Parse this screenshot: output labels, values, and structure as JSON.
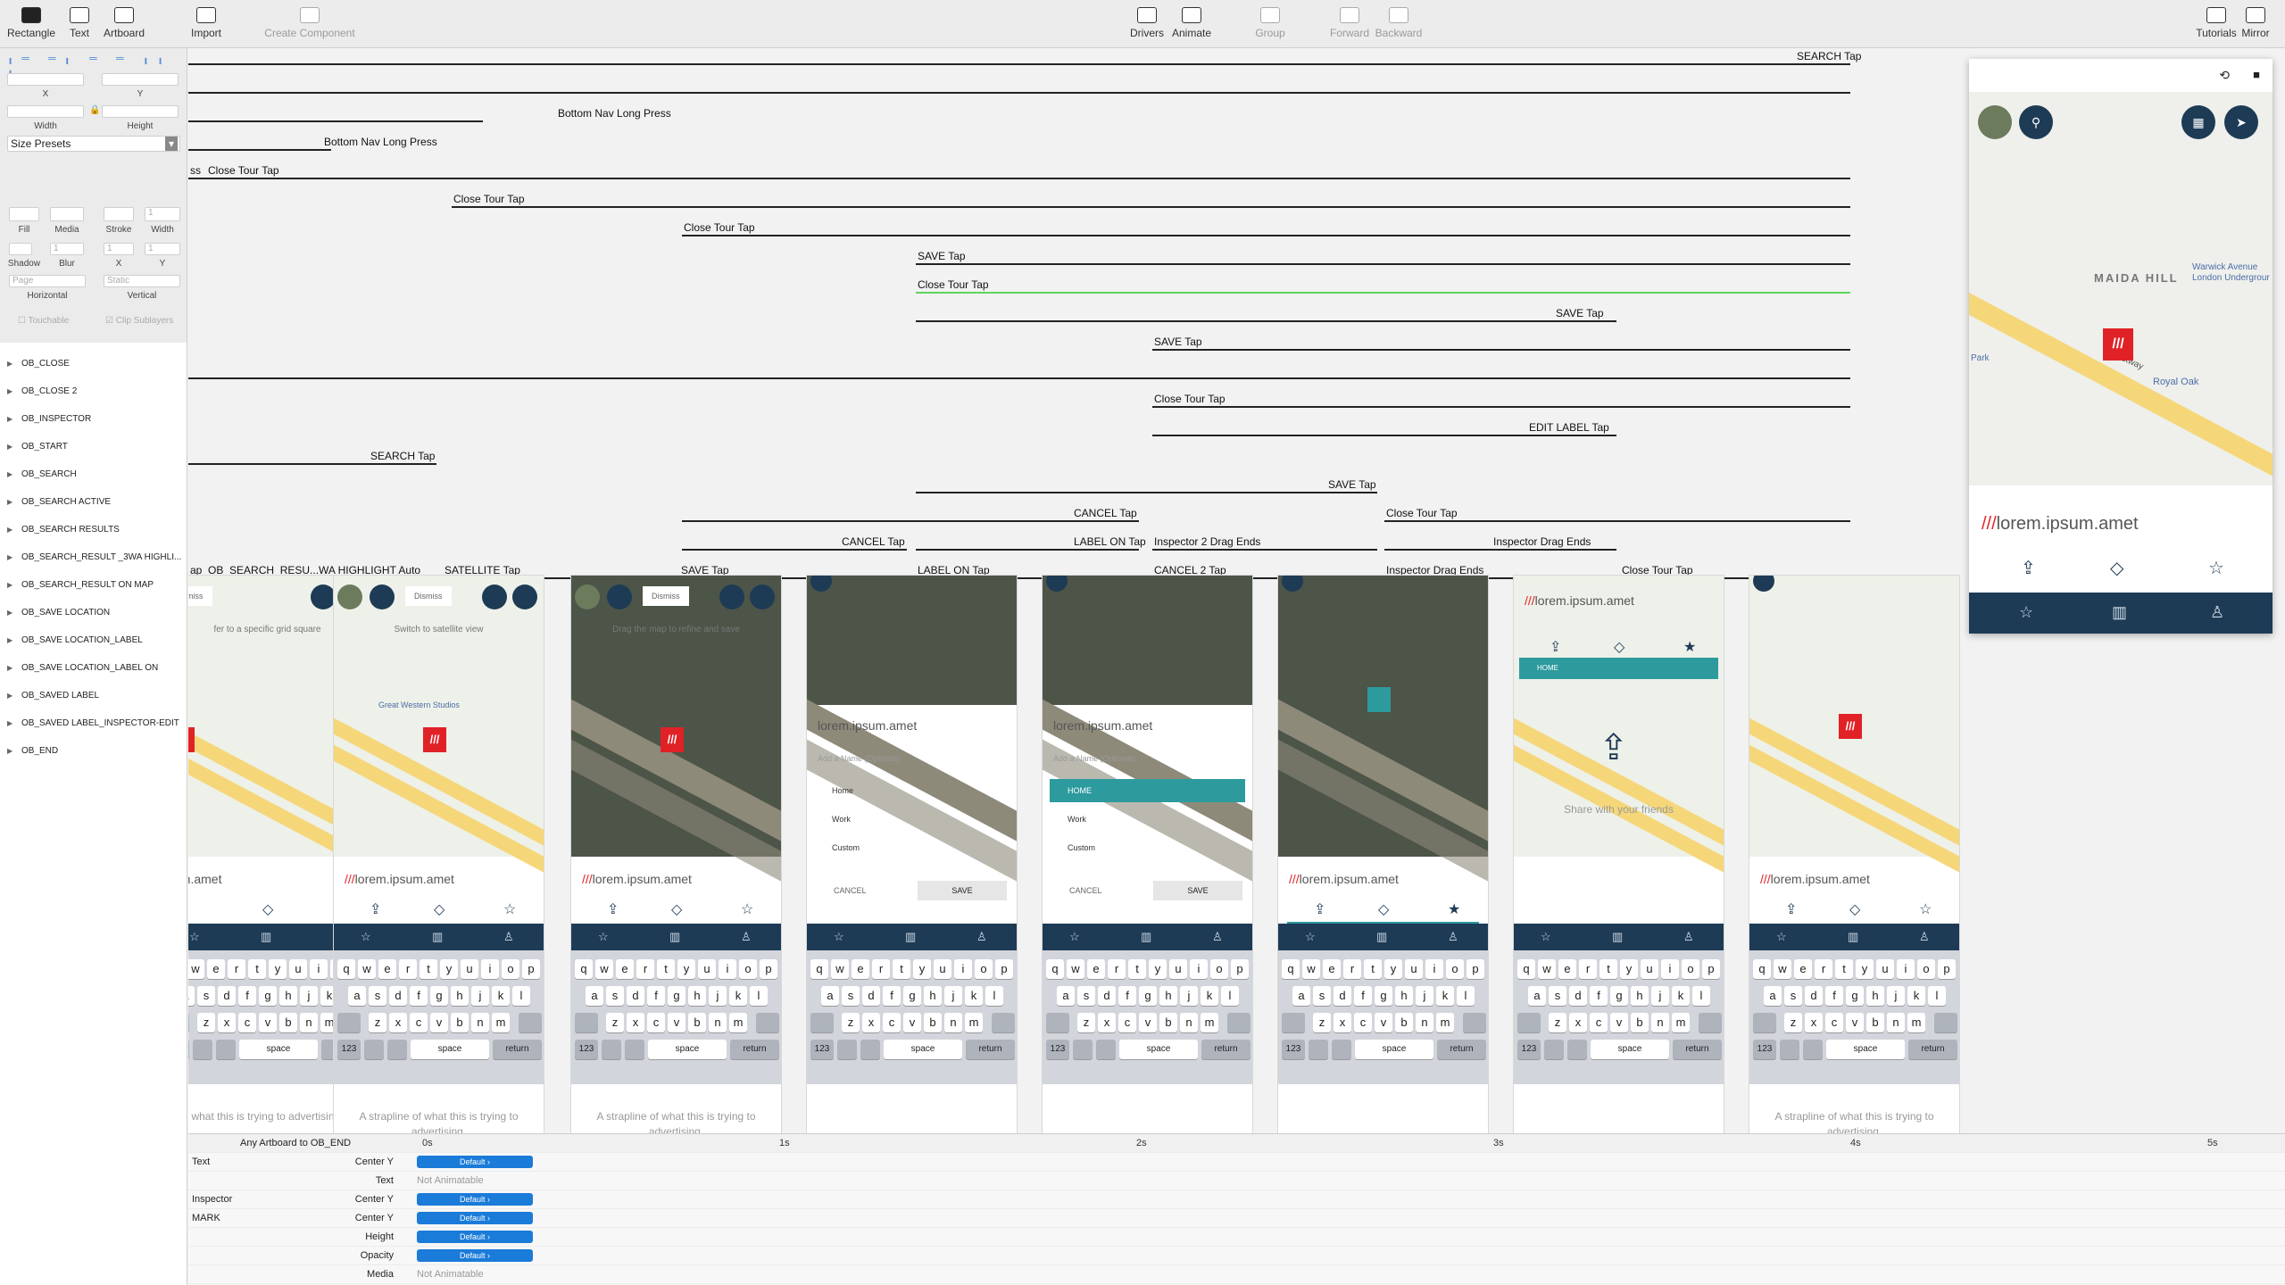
{
  "toolbar": {
    "left": [
      {
        "label": "Rectangle",
        "icon": "rectangle-icon"
      },
      {
        "label": "Text",
        "icon": "text-icon"
      },
      {
        "label": "Artboard",
        "icon": "artboard-icon"
      },
      {
        "label": "Import",
        "icon": "import-icon"
      },
      {
        "label": "Create Component",
        "icon": "component-icon"
      }
    ],
    "middle": [
      {
        "label": "Drivers",
        "icon": "drivers-icon"
      },
      {
        "label": "Animate",
        "icon": "animate-icon"
      },
      {
        "label": "Group",
        "icon": "group-icon"
      },
      {
        "label": "Forward",
        "icon": "forward-icon"
      },
      {
        "label": "Backward",
        "icon": "backward-icon"
      }
    ],
    "right": [
      {
        "label": "Tutorials",
        "icon": "tutorials-icon"
      },
      {
        "label": "Mirror",
        "icon": "mirror-icon"
      }
    ]
  },
  "inspector": {
    "x_label": "X",
    "y_label": "Y",
    "width_label": "Width",
    "height_label": "Height",
    "size_presets": "Size Presets",
    "fill": "Fill",
    "media": "Media",
    "stroke": "Stroke",
    "stroke_width": "Width",
    "stroke_width_value": "1",
    "shadow": "Shadow",
    "blur": "Blur",
    "shadow_x": "X",
    "shadow_y": "Y",
    "blur_value": "1",
    "sx_value": "1",
    "sy_value": "1",
    "horizontal_value": "Page",
    "vertical_value": "Static",
    "horizontal": "Horizontal",
    "vertical": "Vertical",
    "touchable": "Touchable",
    "clip_sublayers": "Clip Sublayers"
  },
  "layers": [
    "OB_CLOSE",
    "OB_CLOSE 2",
    "OB_INSPECTOR",
    "OB_START",
    "OB_SEARCH",
    "OB_SEARCH ACTIVE",
    "OB_SEARCH RESULTS",
    "OB_SEARCH_RESULT _3WA HIGHLI...",
    "OB_SEARCH_RESULT ON MAP",
    "OB_SAVE LOCATION",
    "OB_SAVE LOCATION_LABEL",
    "OB_SAVE LOCATION_LABEL ON",
    "OB_SAVED LABEL",
    "OB_SAVED LABEL_INSPECTOR-EDIT",
    "OB_END"
  ],
  "connections": [
    {
      "label": "SEARCH Tap"
    },
    {
      "label": ""
    },
    {
      "label": "Bottom Nav Long Press"
    },
    {
      "label": "Bottom Nav Long Press"
    },
    {
      "label": "Close Tour Tap"
    },
    {
      "label": "ss"
    },
    {
      "label": "Close Tour Tap"
    },
    {
      "label": "Close Tour Tap"
    },
    {
      "label": "SAVE Tap"
    },
    {
      "label": "Close Tour Tap"
    },
    {
      "label": "SAVE Tap"
    },
    {
      "label": "SAVE Tap"
    },
    {
      "label": ""
    },
    {
      "label": "Close Tour Tap"
    },
    {
      "label": "EDIT LABEL Tap"
    },
    {
      "label": "SEARCH Tap"
    },
    {
      "label": "SAVE Tap"
    },
    {
      "label": "CANCEL Tap"
    },
    {
      "label": "Close Tour Tap"
    },
    {
      "label": "CANCEL Tap"
    },
    {
      "label": "LABEL ON Tap"
    },
    {
      "label": "Inspector 2 Drag Ends"
    },
    {
      "label": "Inspector Drag Ends"
    },
    {
      "label": "ap"
    },
    {
      "label": "OB_SEARCH_RESU...WA HIGHLIGHT Auto"
    },
    {
      "label": "SATELLITE Tap"
    },
    {
      "label": "SAVE Tap"
    },
    {
      "label": "LABEL ON Tap"
    },
    {
      "label": "CANCEL 2 Tap"
    },
    {
      "label": "Inspector Drag Ends"
    },
    {
      "label": "Close Tour Tap"
    }
  ],
  "artboards": {
    "title_prefix": "///",
    "title": "lorem.ipsum.amet",
    "title_cut": "n.amet",
    "strapline": "A strapline of what this is trying to advertising.",
    "strapline_cut": "what this is trying to advertising.",
    "banners": [
      "fer to a specific grid square",
      "Switch to satellite view",
      "Drag the map to refine and save"
    ],
    "search_chip": "Dismiss",
    "name_placeholder": "Add a Name (Optional)",
    "options": [
      "Home",
      "Work",
      "Custom"
    ],
    "home_caps": "HOME",
    "cancel": "CANCEL",
    "save": "SAVE",
    "share_text": "Share with your friends",
    "map_place": "Great Western Studios",
    "keyboard": {
      "row1": [
        "q",
        "w",
        "e",
        "r",
        "t",
        "y",
        "u",
        "i",
        "o",
        "p"
      ],
      "row2": [
        "a",
        "s",
        "d",
        "f",
        "g",
        "h",
        "j",
        "k",
        "l"
      ],
      "row3": [
        "z",
        "x",
        "c",
        "v",
        "b",
        "n",
        "m"
      ],
      "space": "space",
      "return": "return",
      "numbers": "123"
    }
  },
  "preview": {
    "title": "lorem.ipsum.amet",
    "title_prefix": "///",
    "places": [
      "MAIDA HILL",
      "Warwick Avenue",
      "London Undergrour",
      "Royal Oak",
      "Westway",
      "Park"
    ]
  },
  "timeline": {
    "header": "Any Artboard to OB_END",
    "ticks": [
      "0s",
      "1s",
      "2s",
      "3s",
      "4s",
      "5s"
    ],
    "rows": [
      {
        "layer": "Text",
        "prop": "Center Y",
        "value": "Default ›",
        "pill": true
      },
      {
        "layer": "",
        "prop": "Text",
        "value": "Not Animatable",
        "pill": false
      },
      {
        "layer": "Inspector",
        "prop": "Center Y",
        "value": "Default ›",
        "pill": true
      },
      {
        "layer": "MARK",
        "prop": "Center Y",
        "value": "Default ›",
        "pill": true
      },
      {
        "layer": "",
        "prop": "Height",
        "value": "Default ›",
        "pill": true
      },
      {
        "layer": "",
        "prop": "Opacity",
        "value": "Default ›",
        "pill": true
      },
      {
        "layer": "",
        "prop": "Media",
        "value": "Not Animatable",
        "pill": false
      }
    ]
  },
  "colors": {
    "accent": "#1e3b56",
    "brand_red": "#e02227",
    "teal": "#2d9a9e",
    "timeline_pill": "#1a7bd9",
    "green_connection": "#5ed65e"
  }
}
